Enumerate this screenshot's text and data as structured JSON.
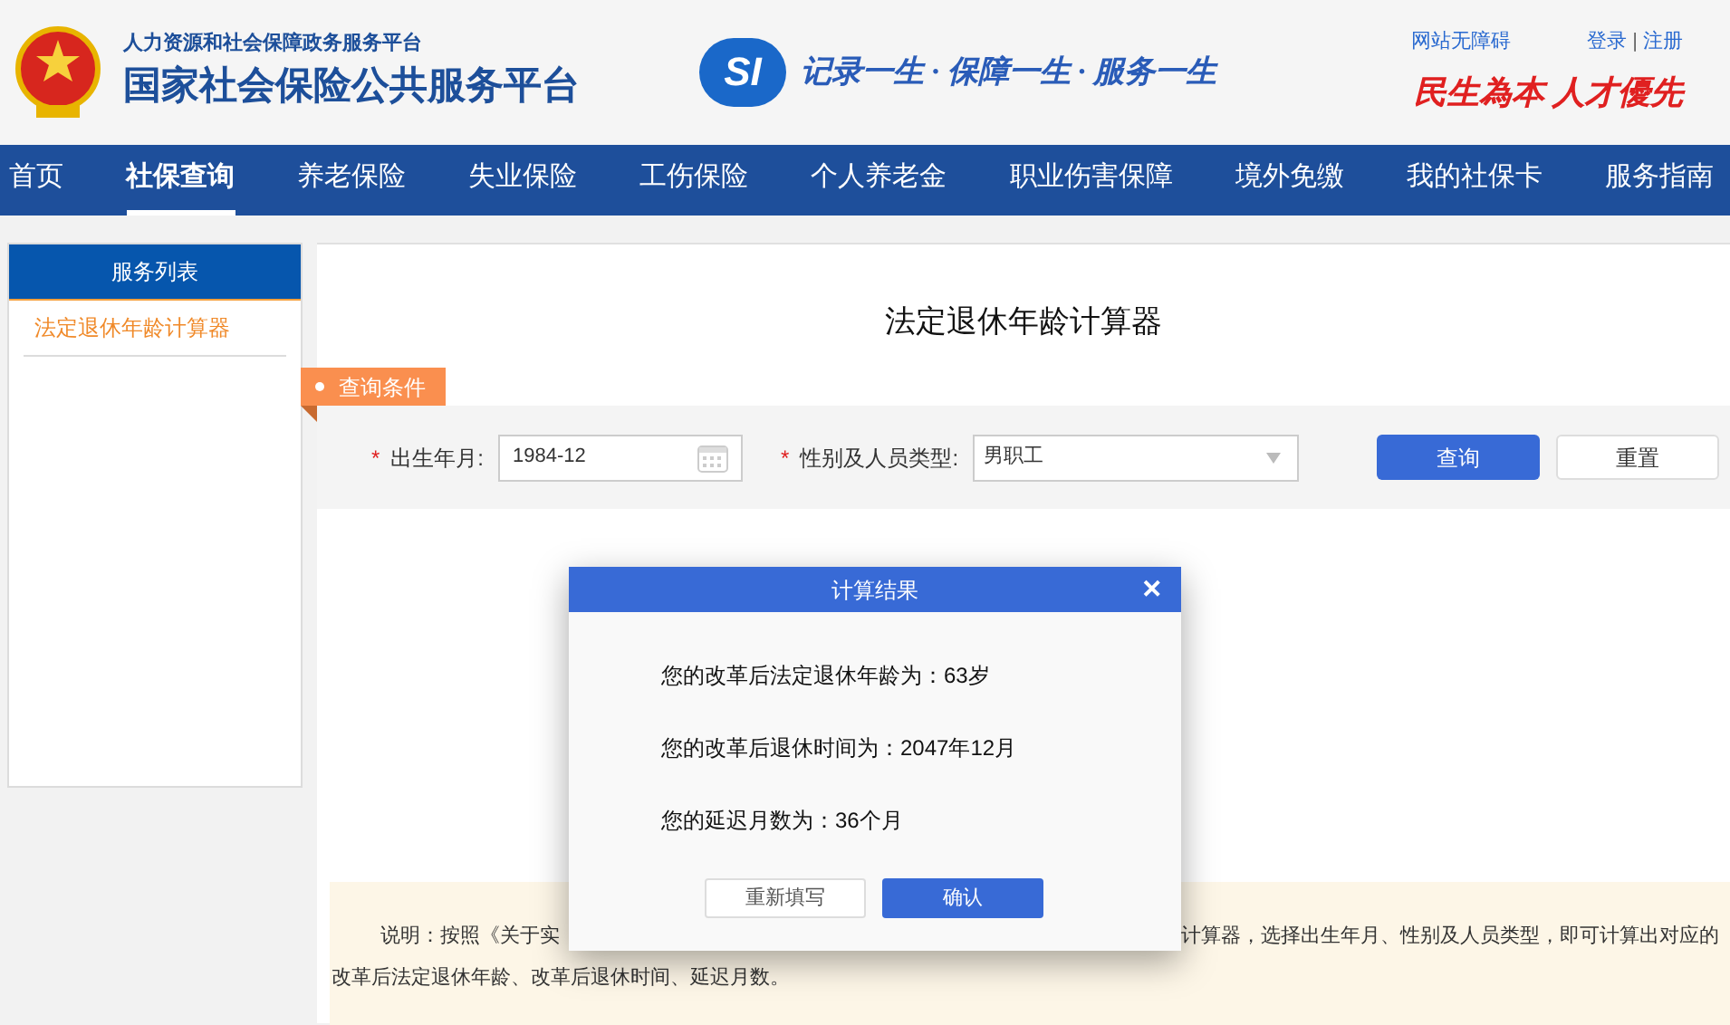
{
  "header": {
    "subtitle": "人力资源和社会保障政务服务平台",
    "title": "国家社会保险公共服务平台",
    "logo_text": "SI",
    "slogan": "记录一生 · 保障一生 · 服务一生",
    "red_slogan": "民生為本 人才優先",
    "accessibility_link": "网站无障碍",
    "login_link": "登录",
    "separator": "|",
    "register_link": "注册"
  },
  "nav": [
    {
      "label": "首页",
      "selected": false
    },
    {
      "label": "社保查询",
      "selected": true
    },
    {
      "label": "养老保险",
      "selected": false
    },
    {
      "label": "失业保险",
      "selected": false
    },
    {
      "label": "工伤保险",
      "selected": false
    },
    {
      "label": "个人养老金",
      "selected": false
    },
    {
      "label": "职业伤害保障",
      "selected": false
    },
    {
      "label": "境外免缴",
      "selected": false
    },
    {
      "label": "我的社保卡",
      "selected": false
    },
    {
      "label": "服务指南",
      "selected": false
    }
  ],
  "sidebar": {
    "title": "服务列表",
    "items": [
      {
        "label": "法定退休年龄计算器",
        "selected": true
      }
    ]
  },
  "main": {
    "title": "法定退休年龄计算器",
    "section_tag": "查询条件",
    "form": {
      "birth_label": "出生年月:",
      "birth_value": "1984-12",
      "type_label": "性别及人员类型:",
      "type_value": "男职工",
      "required_mark": "*",
      "query_button": "查询",
      "reset_button": "重置"
    },
    "note": {
      "line_1_start": "说明：按照《关于实",
      "line_1_end": "计算器，选择出生年月、性别及人员类型，即可计算出对应的",
      "line_2": "改革后法定退休年龄、改革后退休时间、延迟月数。"
    }
  },
  "dialog": {
    "title": "计算结果",
    "close": "✕",
    "lines": [
      "您的改革后法定退休年龄为：63岁",
      "您的改革后退休时间为：2047年12月",
      "您的延迟月数为：36个月"
    ],
    "buttons": [
      {
        "label": "重新填写",
        "kind": "secondary"
      },
      {
        "label": "确认",
        "kind": "primary"
      }
    ]
  }
}
